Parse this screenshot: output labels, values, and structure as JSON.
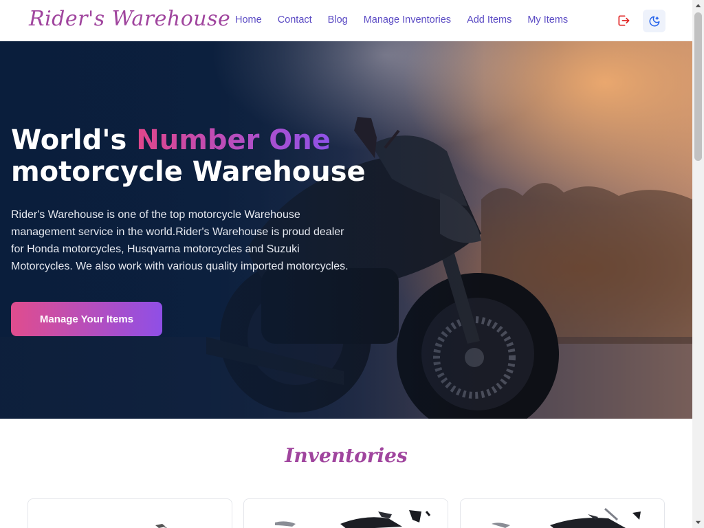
{
  "nav": {
    "brand": "Rider's Warehouse",
    "links": [
      "Home",
      "Contact",
      "Blog",
      "Manage Inventories",
      "Add Items",
      "My Items"
    ],
    "logout_icon": "logout-icon",
    "theme_icon": "moon-icon"
  },
  "hero": {
    "title_part1": "World's ",
    "title_highlight": "Number One",
    "title_line2": "motorcycle Warehouse",
    "description": "Rider's Warehouse is one of the top motorcycle Warehouse management service in the world.Rider's Warehouse is proud dealer for Honda motorcycles, Husqvarna motorcycles and Suzuki Motorcycles. We also work with various quality imported motorcycles.",
    "button_label": "Manage Your Items"
  },
  "inventories": {
    "title": "Inventories"
  },
  "colors": {
    "brand": "#a0459e",
    "nav_link": "#5b4bc4",
    "logout": "#e02424",
    "theme_icon": "#2563eb",
    "hero_dark": "#0c1e3c",
    "button_start": "#e04d8e",
    "button_end": "#8f4fe6"
  }
}
